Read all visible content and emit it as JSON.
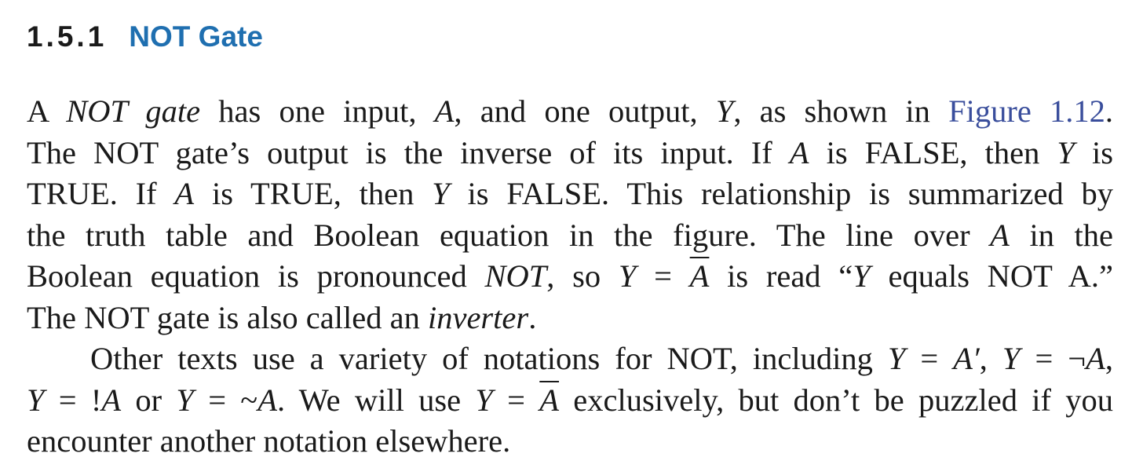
{
  "section": {
    "number": "1.5.1",
    "title": "NOT Gate"
  },
  "paragraph1": {
    "lines": [
      [
        "A ",
        "NOT gate",
        " has one input, ",
        "A",
        ", and one output, ",
        "Y",
        ", as shown in ",
        "Figure 1.12",
        "."
      ],
      [
        "The NOT gate’s output is the inverse of its input. If ",
        "A",
        " is FALSE, then ",
        "Y",
        " is"
      ],
      [
        "TRUE. If ",
        "A",
        " is TRUE, then ",
        "Y",
        " is FALSE. This relationship is summarized by"
      ],
      [
        "the truth table and Boolean equation in the figure. The line over ",
        "A",
        " in the"
      ],
      [
        "Boolean equation is pronounced ",
        "NOT",
        ", so ",
        "Y",
        " = ",
        "A",
        " is read “",
        "Y",
        " equals NOT A.”"
      ],
      [
        "The NOT gate is also called an ",
        "inverter",
        "."
      ]
    ]
  },
  "paragraph2": {
    "lines": [
      [
        "Other texts use a variety of notations for NOT, including ",
        "Y",
        " = ",
        "A′",
        ", ",
        "Y",
        " = ¬",
        "A",
        ","
      ],
      [
        "Y",
        " = !",
        "A",
        " or ",
        "Y",
        " = ~",
        "A",
        ". We will use ",
        "Y",
        " = ",
        "A",
        " exclusively, but don’t be puzzled if you"
      ],
      [
        "encounter another notation elsewhere."
      ]
    ]
  }
}
